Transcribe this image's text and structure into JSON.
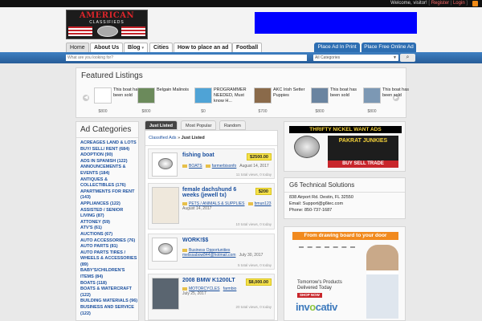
{
  "topbar": {
    "welcome": "Welcome, visitor!",
    "register": "Register",
    "login": "Login"
  },
  "header": {
    "logo_text": "AMERICAN",
    "logo_sub": "CLASSIFIEDS"
  },
  "nav": {
    "items": [
      {
        "label": "Home"
      },
      {
        "label": "About Us"
      },
      {
        "label": "Blog",
        "chevron": "▾"
      },
      {
        "label": "Cities"
      },
      {
        "label": "How to place an ad"
      },
      {
        "label": "Football"
      }
    ],
    "print_button": "Place Ad In Print",
    "post_button": "Place Free Online Ad"
  },
  "search": {
    "placeholder": "What are you looking for?",
    "category": "All Categories",
    "go": "⌕"
  },
  "featured": {
    "title": "Featured Listings",
    "items": [
      {
        "title": "This boat has been sold",
        "price": "$800"
      },
      {
        "title": "Belgain Malinois",
        "price": "$800"
      },
      {
        "title": "PROGRAMMER NEEDED, Must know H...",
        "price": "$0"
      },
      {
        "title": "AKC Irish Setter Puppies",
        "price": "$700"
      },
      {
        "title": "This boat has been sold",
        "price": "$800"
      },
      {
        "title": "This boat has been sold",
        "price": "$800"
      }
    ]
  },
  "sidebar": {
    "title": "Ad Categories",
    "categories": [
      "ACREAGES LAND & LOTS",
      "BUY/ SELL/ RENT (684)",
      "ADOPTION (90)",
      "ADS IN SPANISH (122)",
      "ANNOUNCEMENTS &",
      "EVENTS (184)",
      "ANTIQUES &",
      "COLLECTIBLES (176)",
      "APARTMENTS FOR RENT",
      "(143)",
      "APPLIANCES (122)",
      "ASSISTED / SENIOR",
      "LIVING (87)",
      "ATTONEY (59)",
      "ATV'S (61)",
      "AUCTIONS (67)",
      "AUTO ACCESSORIES (76)",
      "AUTO PARTS (81)",
      "AUTO PARTS TIRES /",
      "WHEELS & ACCESSORIES",
      "(89)",
      "BABY'S/CHILDREN'S",
      "ITEMS (84)",
      "BOATS (118)",
      "BOATS & WATERCRAFT",
      "(122)",
      "BUILDING MATERIALS (96)",
      "BUSINESS AND SERVICE",
      "(122)"
    ]
  },
  "center": {
    "tabs": [
      "Just Listed",
      "Most Popular",
      "Random"
    ],
    "crumb_prefix": "Classified Ads",
    "crumb_current": "Just Listed",
    "listings": [
      {
        "title": "fishing boat",
        "price": "$2500.00",
        "category": "BOATS",
        "user": "farmerbisonfo",
        "date": "August 14, 2017",
        "stats": "11 total views, 0 today"
      },
      {
        "title": "female dachshund 6 weeks (jewell tx)",
        "price": "$200",
        "category": "PETS / ANIMALS & SUPPLIES",
        "user": "bmun123",
        "date": "August 14, 2017",
        "stats": "10 total views, 0 today"
      },
      {
        "title": "WORK!$$",
        "price": "",
        "category": "Business Opportunities",
        "user": "melissabow844@hotmail.com",
        "date": "July 30, 2017",
        "stats": "5 total views, 0 today"
      },
      {
        "title": "2008 BMW K1200LT",
        "price": "$8,000.00",
        "category": "MOTORCYCLES",
        "user": "farmbio",
        "date": "July 25, 2017",
        "stats": "20 total views, 0 today"
      }
    ]
  },
  "right": {
    "thrifty_head": "THRIFTY NICKEL WANT ADS",
    "pakrat": "PAKRAT JUNKIES",
    "pakrat_foot": "BUY SELL TRADE",
    "g6_title": "G6 Technical Solutions",
    "g6_address": "838 Airport Rd. Destin, FL 32550",
    "g6_email": "Email: Support@g6tec.com",
    "g6_phone": "Phone: 850-737-1687",
    "inv_top": "From drawing board to your door",
    "inv_text1": "Tomorrow's Products",
    "inv_text2": "Delivered Today",
    "inv_shop": "SHOP NOW",
    "inv_logo_a": "inv",
    "inv_logo_b": "o",
    "inv_logo_c": "cativ"
  }
}
